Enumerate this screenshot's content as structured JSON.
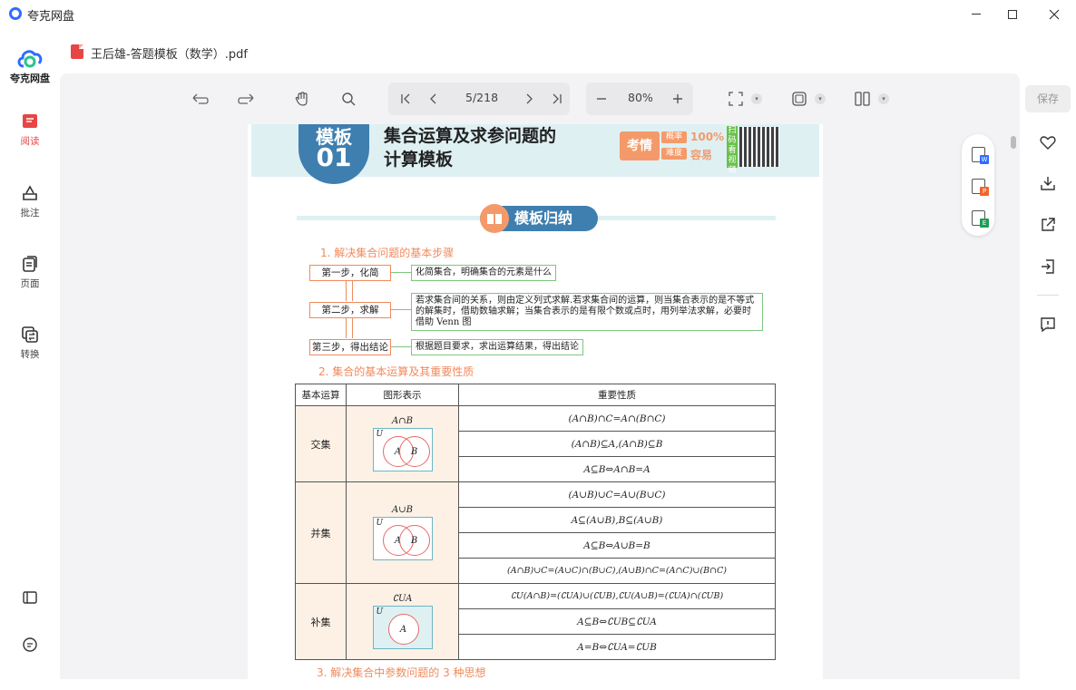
{
  "window": {
    "title": "夸克网盘"
  },
  "brand": {
    "label": "夸克网盘"
  },
  "sidebar": {
    "items": [
      {
        "label": "阅读"
      },
      {
        "label": "批注"
      },
      {
        "label": "页面"
      },
      {
        "label": "转换"
      }
    ]
  },
  "file": {
    "name": "王后雄-答题模板（数学）.pdf"
  },
  "toolbar": {
    "page_indicator": "5/218",
    "zoom": "80%"
  },
  "save_label": "保存",
  "doc": {
    "badge_line1": "模板",
    "badge_line2": "01",
    "title_line1": "集合运算及求参问题的",
    "title_line2": "计算模板",
    "kaoqing": "考情",
    "gailv_tag": "概率",
    "gailv_val": "100%",
    "nandu_tag": "难度",
    "nandu_val": "容易",
    "scan_text": "扫码看视频",
    "section_title": "模板归纳",
    "h1": "1. 解决集合问题的基本步骤",
    "steps": [
      {
        "label": "第一步，化简",
        "desc": "化简集合，明确集合的元素是什么"
      },
      {
        "label": "第二步，求解",
        "desc": "若求集合间的关系，则由定义列式求解.若求集合间的运算，则当集合表示的是不等式的解集时，借助数轴求解；当集合表示的是有限个数或点时，用列举法求解，必要时借助 Venn 图"
      },
      {
        "label": "第三步，得出结论",
        "desc": "根据题目要求，求出运算结果，得出结论"
      }
    ],
    "h2": "2. 集合的基本运算及其重要性质",
    "table_headers": [
      "基本运算",
      "图形表示",
      "重要性质"
    ],
    "ops": [
      {
        "name": "交集",
        "caption": "A∩B",
        "u": "U",
        "a": "A",
        "b": "B",
        "props": [
          "(A∩B)∩C=A∩(B∩C)",
          "(A∩B)⊆A,(A∩B)⊆B",
          "A⊆B⇔A∩B=A"
        ]
      },
      {
        "name": "并集",
        "caption": "A∪B",
        "u": "U",
        "a": "A",
        "b": "B",
        "props": [
          "(A∪B)∪C=A∪(B∪C)",
          "A⊆(A∪B),B⊆(A∪B)",
          "A⊆B⇔A∪B=B",
          "(A∩B)∪C=(A∪C)∩(B∪C),(A∪B)∩C=(A∩C)∪(B∩C)"
        ]
      },
      {
        "name": "补集",
        "caption": "∁UA",
        "u": "U",
        "a": "A",
        "b": "",
        "props": [
          "∁U(A∩B)=(∁UA)∪(∁UB),∁U(A∪B)=(∁UA)∩(∁UB)",
          "A⊆B⇔∁UB⊆∁UA",
          "A=B⇔∁UA=∁UB"
        ]
      }
    ],
    "h3": "3. 解决集合中参数问题的 3 种思想"
  },
  "float_tools": [
    {
      "letter": "W",
      "color": "#2f6bff"
    },
    {
      "letter": "P",
      "color": "#f0662e"
    },
    {
      "letter": "E",
      "color": "#1e9d55"
    }
  ]
}
